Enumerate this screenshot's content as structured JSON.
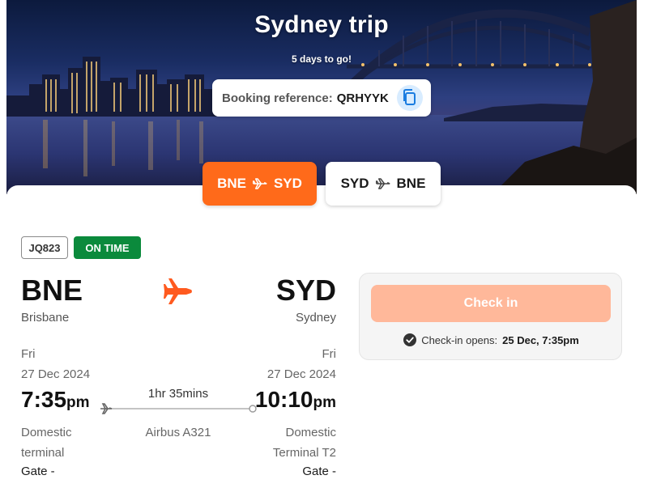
{
  "hero": {
    "title": "Sydney trip",
    "countdown": "5 days to go!",
    "booking_label": "Booking reference:",
    "booking_code": "QRHYYK"
  },
  "tabs": [
    {
      "from": "BNE",
      "to": "SYD",
      "active": true
    },
    {
      "from": "SYD",
      "to": "BNE",
      "active": false
    }
  ],
  "flight": {
    "number": "JQ823",
    "status": "ON TIME",
    "duration": "1hr 35mins",
    "aircraft": "Airbus A321",
    "departure": {
      "code": "BNE",
      "city": "Brisbane",
      "day": "Fri",
      "date": "27 Dec 2024",
      "time": "7:35",
      "ampm": "pm",
      "terminal_line1": "Domestic",
      "terminal_line2": "terminal",
      "gate": "Gate -"
    },
    "arrival": {
      "code": "SYD",
      "city": "Sydney",
      "day": "Fri",
      "date": "27 Dec 2024",
      "time": "10:10",
      "ampm": "pm",
      "terminal_line1": "Domestic",
      "terminal_line2": "Terminal T2",
      "gate": "Gate -"
    }
  },
  "checkin": {
    "button_label": "Check in",
    "opens_label": "Check-in opens:",
    "opens_value": "25 Dec, 7:35pm"
  },
  "colors": {
    "brand_orange": "#ff6a1a",
    "plane_orange": "#ff5a1f",
    "status_green": "#0b8a3c",
    "checkin_disabled": "#ffb89a"
  }
}
